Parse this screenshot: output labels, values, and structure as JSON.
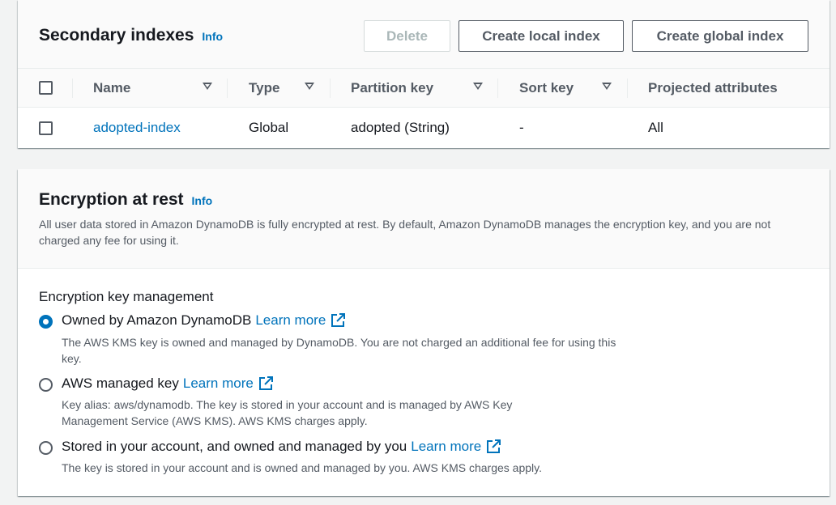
{
  "secondary_indexes": {
    "title": "Secondary indexes",
    "info": "Info",
    "buttons": {
      "delete": "Delete",
      "create_local": "Create local index",
      "create_global": "Create global index"
    },
    "columns": [
      "Name",
      "Type",
      "Partition key",
      "Sort key",
      "Projected attributes"
    ],
    "rows": [
      {
        "name": "adopted-index",
        "type": "Global",
        "partition_key": "adopted (String)",
        "sort_key": "-",
        "projected": "All"
      }
    ]
  },
  "encryption": {
    "title": "Encryption at rest",
    "info": "Info",
    "description": "All user data stored in Amazon DynamoDB is fully encrypted at rest. By default, Amazon DynamoDB manages the encryption key, and you are not charged any fee for using it.",
    "key_management_label": "Encryption key management",
    "options": [
      {
        "label": "Owned by Amazon DynamoDB",
        "learn_more": "Learn more",
        "description": "The AWS KMS key is owned and managed by DynamoDB. You are not charged an additional fee for using this key.",
        "selected": true
      },
      {
        "label": "AWS managed key",
        "learn_more": "Learn more",
        "description": "Key alias: aws/dynamodb. The key is stored in your account and is managed by AWS Key Management Service (AWS KMS). AWS KMS charges apply.",
        "selected": false
      },
      {
        "label": "Stored in your account, and owned and managed by you",
        "learn_more": "Learn more",
        "description": "The key is stored in your account and is owned and managed by you. AWS KMS charges apply.",
        "selected": false
      }
    ]
  },
  "colors": {
    "link": "#0073bb",
    "text": "#16191f",
    "secondary_text": "#545b64",
    "header_bg": "#fafafa",
    "page_bg": "#f2f3f3"
  }
}
